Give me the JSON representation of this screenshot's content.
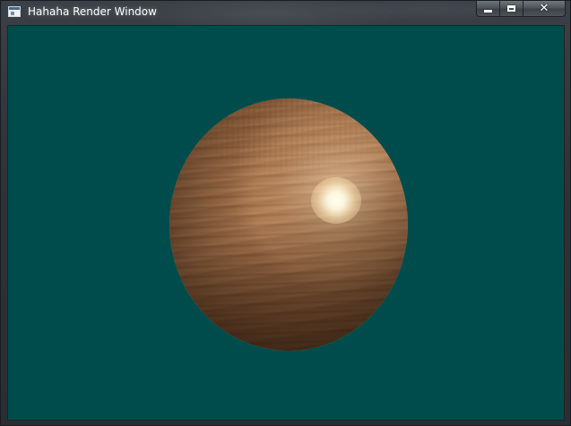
{
  "window": {
    "title": "Hahaha Render Window",
    "background_color": "#004c4c"
  },
  "titlebar": {
    "icon": "app-window-icon",
    "buttons": {
      "minimize_icon": "minimize-icon",
      "maximize_icon": "maximize-icon",
      "close_label": "✕"
    }
  },
  "scene": {
    "object": "wood-textured-sphere",
    "sphere_color": "#b5825a"
  }
}
